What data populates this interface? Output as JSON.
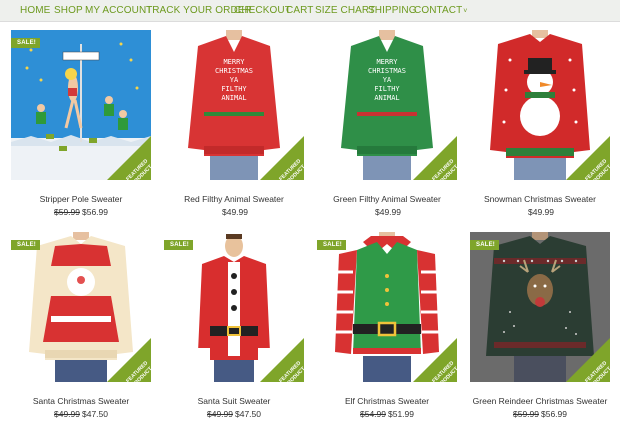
{
  "nav": {
    "items": [
      "HOME",
      "SHOP",
      "MY ACCOUNT",
      "TRACK YOUR ORDER",
      "CHECKOUT",
      "CART",
      "SIZE CHART",
      "SHIPPING",
      "CONTACT"
    ],
    "contact_chevron": "˅"
  },
  "badges": {
    "sale": "SALE!",
    "featured_line1": "FEATURED",
    "featured_line2": "PRODUCT"
  },
  "products": [
    {
      "name": "Stripper Pole Sweater",
      "old_price": "$59.99",
      "price": "$56.99",
      "sale": true,
      "featured": true,
      "image": "stripper-pole-sweater"
    },
    {
      "name": "Red Filthy Animal Sweater",
      "old_price": "",
      "price": "$49.99",
      "sale": false,
      "featured": true,
      "image": "red-filthy-animal-sweater",
      "shirt_text": [
        "MERRY",
        "CHRISTMAS",
        "YA",
        "FILTHY",
        "ANIMAL"
      ]
    },
    {
      "name": "Green Filthy Animal Sweater",
      "old_price": "",
      "price": "$49.99",
      "sale": false,
      "featured": true,
      "image": "green-filthy-animal-sweater",
      "shirt_text": [
        "MERRY",
        "CHRISTMAS",
        "YA",
        "FILTHY",
        "ANIMAL"
      ]
    },
    {
      "name": "Snowman Christmas Sweater",
      "old_price": "",
      "price": "$49.99",
      "sale": false,
      "featured": true,
      "image": "snowman-christmas-sweater"
    },
    {
      "name": "Santa Christmas Sweater",
      "old_price": "$49.99",
      "price": "$47.50",
      "sale": true,
      "featured": true,
      "image": "santa-christmas-sweater"
    },
    {
      "name": "Santa Suit Sweater",
      "old_price": "$49.99",
      "price": "$47.50",
      "sale": true,
      "featured": true,
      "image": "santa-suit-sweater"
    },
    {
      "name": "Elf Christmas Sweater",
      "old_price": "$54.99",
      "price": "$51.99",
      "sale": true,
      "featured": true,
      "image": "elf-christmas-sweater"
    },
    {
      "name": "Green Reindeer Christmas Sweater",
      "old_price": "$59.99",
      "price": "$56.99",
      "sale": true,
      "featured": true,
      "image": "green-reindeer-christmas-sweater"
    }
  ],
  "colors": {
    "accent": "#7fa52a",
    "nav_text": "#6d9a1f",
    "nav_bg": "#eef0ed"
  }
}
